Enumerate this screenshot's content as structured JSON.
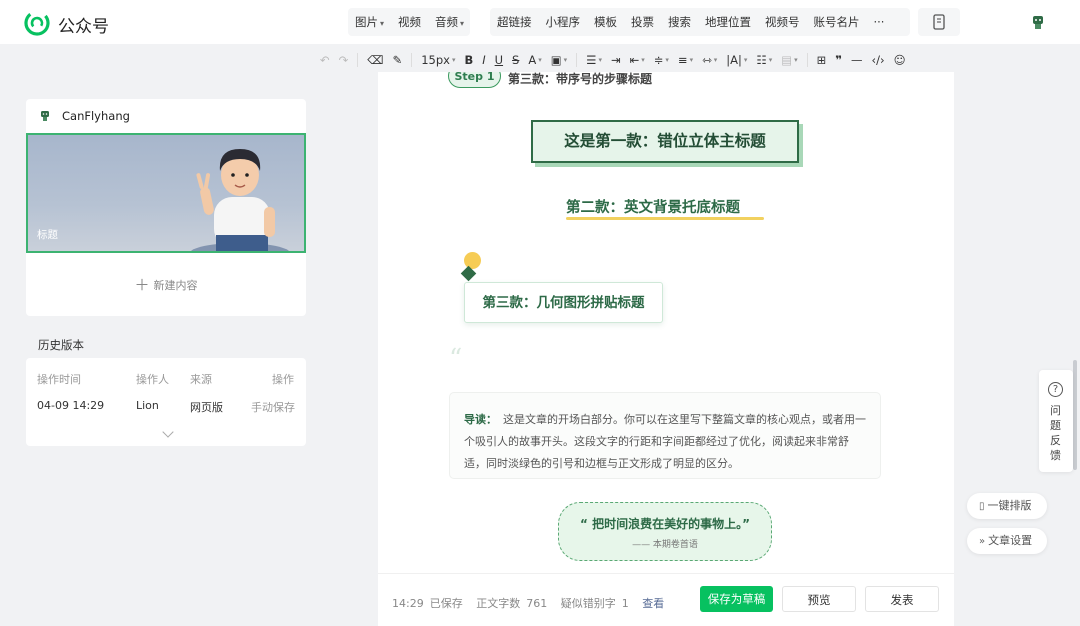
{
  "header": {
    "brand": "公众号",
    "insert_menu": [
      {
        "label": "图片",
        "dropdown": true
      },
      {
        "label": "视频",
        "dropdown": false
      },
      {
        "label": "音频",
        "dropdown": true
      }
    ],
    "feature_menu": [
      "超链接",
      "小程序",
      "模板",
      "投票",
      "搜索",
      "地理位置",
      "视频号",
      "账号名片"
    ],
    "more": "···"
  },
  "toolbar": {
    "font_size": "15px",
    "bold": "B",
    "italic": "I",
    "underline": "U",
    "strike": "S",
    "font_color": "A",
    "quote": "❞",
    "hr": "—",
    "code": "‹/›"
  },
  "left": {
    "account_name": "CanFlyhang",
    "cover_title": "标题",
    "new_content": "新建内容",
    "history_title": "历史版本",
    "history_headers": [
      "操作时间",
      "操作人",
      "来源",
      "操作"
    ],
    "history_rows": [
      [
        "04-09 14:29",
        "Lion",
        "网页版",
        "手动保存"
      ]
    ]
  },
  "editor": {
    "step_pill": "Step 1",
    "step_text": "第三款：带序号的步骤标题",
    "title1": "这是第一款：错位立体主标题",
    "title2": "第二款：英文背景托底标题",
    "title3": "第三款：几何图形拼贴标题",
    "quote_mark": "“",
    "intro_lead": "导读：",
    "intro_body": "这是文章的开场白部分。你可以在这里写下整篇文章的核心观点，或者用一个吸引人的故事开头。这段文字的行距和字间距都经过了优化，阅读起来非常舒适，同时淡绿色的引号和边框与正文形成了明显的区分。",
    "bubble_main": "“ 把时间浪费在美好的事物上。”",
    "bubble_sub": "—— 本期卷首语"
  },
  "status": {
    "time": "14:29",
    "saved": "已保存",
    "word_label": "正文字数",
    "word_count": "761",
    "typo_label": "疑似错别字",
    "typo_count": "1",
    "view_link": "查看"
  },
  "actions": {
    "save_draft": "保存为草稿",
    "preview": "预览",
    "publish": "发表"
  },
  "side": {
    "feedback": "问题反馈",
    "one_click": "一键排版",
    "article_settings": "文章设置"
  },
  "colors": {
    "accent_green": "#07c160",
    "title_green": "#2d6a47",
    "highlight_yellow": "#f2d15f"
  }
}
